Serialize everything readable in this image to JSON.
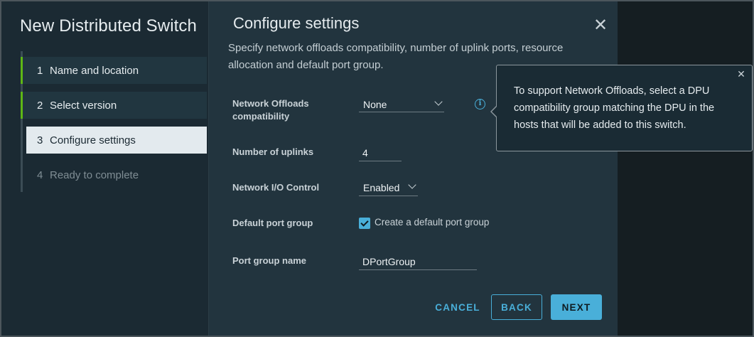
{
  "wizard": {
    "title": "New Distributed Switch",
    "steps": [
      {
        "num": "1",
        "label": "Name and location",
        "state": "completed"
      },
      {
        "num": "2",
        "label": "Select version",
        "state": "completed"
      },
      {
        "num": "3",
        "label": "Configure settings",
        "state": "active"
      },
      {
        "num": "4",
        "label": "Ready to complete",
        "state": "disabled"
      }
    ]
  },
  "dialog": {
    "title": "Configure settings",
    "description": "Specify network offloads compatibility, number of uplink ports, resource allocation and default port group.",
    "fields": {
      "network_offloads": {
        "label": "Network Offloads compatibility",
        "value": "None"
      },
      "uplinks": {
        "label": "Number of uplinks",
        "value": "4"
      },
      "nioc": {
        "label": "Network I/O Control",
        "value": "Enabled"
      },
      "default_port_group": {
        "label": "Default port group",
        "checkbox_label": "Create a default port group",
        "checked": true
      },
      "port_group_name": {
        "label": "Port group name",
        "value": "DPortGroup"
      }
    },
    "buttons": {
      "cancel": "CANCEL",
      "back": "BACK",
      "next": "NEXT"
    }
  },
  "tooltip": {
    "text": "To support Network Offloads, select a DPU compatibility group matching the DPU in the hosts that will be added to this switch."
  },
  "icons": {
    "close": "close-icon",
    "info": "info-icon",
    "chevron": "chevron-down-icon",
    "check": "check-icon"
  },
  "colors": {
    "accent": "#49afd9",
    "step_done": "#5eb715",
    "bg_left": "#1b2a33",
    "bg_right": "#22343e"
  }
}
